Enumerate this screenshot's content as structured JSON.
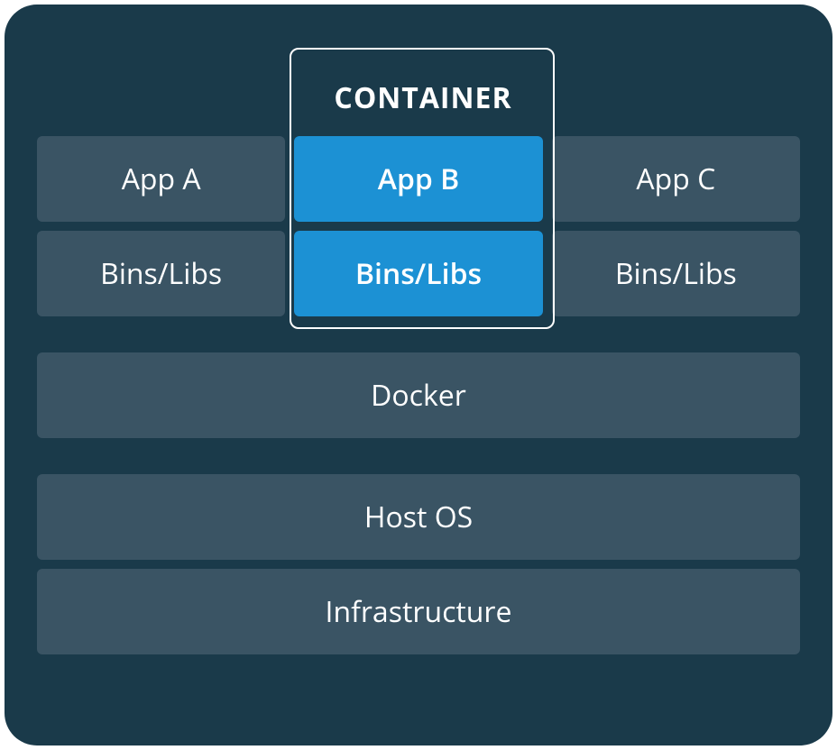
{
  "diagram": {
    "container_label": "CONTAINER",
    "apps_row": [
      {
        "label": "App A",
        "highlighted": false
      },
      {
        "label": "App B",
        "highlighted": true
      },
      {
        "label": "App C",
        "highlighted": false
      }
    ],
    "libs_row": [
      {
        "label": "Bins/Libs",
        "highlighted": false
      },
      {
        "label": "Bins/Libs",
        "highlighted": true
      },
      {
        "label": "Bins/Libs",
        "highlighted": false
      }
    ],
    "docker_label": "Docker",
    "host_os_label": "Host OS",
    "infrastructure_label": "Infrastructure",
    "colors": {
      "panel_bg": "#1a3a4a",
      "cell_bg": "#3a5464",
      "highlight_bg": "#1c91d4",
      "text": "#ffffff"
    }
  }
}
